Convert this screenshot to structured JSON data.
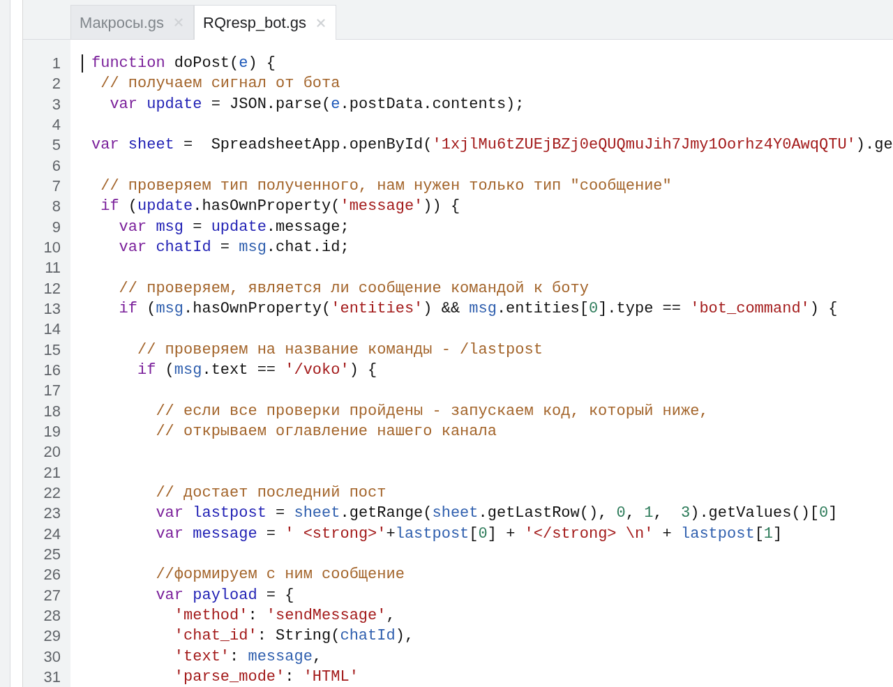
{
  "tabs": [
    {
      "label": "Макросы.gs",
      "selected": false
    },
    {
      "label": "RQresp_bot.gs",
      "selected": true
    }
  ],
  "lines": [
    {
      "number": "1",
      "tokens": [
        {
          "kind": "keyword",
          "text": "function"
        },
        {
          "kind": "plain",
          "text": " doPost("
        },
        {
          "kind": "param",
          "text": "e"
        },
        {
          "kind": "plain",
          "text": ") {"
        }
      ]
    },
    {
      "number": "2",
      "tokens": [
        {
          "kind": "comment",
          "text": " // получаем сигнал от бота"
        }
      ]
    },
    {
      "number": "3",
      "tokens": [
        {
          "kind": "keyword",
          "text": "  var "
        },
        {
          "kind": "def",
          "text": "update"
        },
        {
          "kind": "plain",
          "text": " = JSON.parse("
        },
        {
          "kind": "param",
          "text": "e"
        },
        {
          "kind": "plain",
          "text": ".postData.contents);"
        }
      ]
    },
    {
      "number": "4"
    },
    {
      "number": "5",
      "tokens": [
        {
          "kind": "keyword",
          "text": "var "
        },
        {
          "kind": "def",
          "text": "sheet"
        },
        {
          "kind": "plain",
          "text": " =  SpreadsheetApp.openById("
        },
        {
          "kind": "string",
          "text": "'1xjlMu6tZUEjBZj0eQUQmuJih7Jmy1Oorhz4Y0AwqQTU'"
        },
        {
          "kind": "plain",
          "text": ").ge"
        }
      ]
    },
    {
      "number": "6"
    },
    {
      "number": "7",
      "tokens": [
        {
          "kind": "comment",
          "text": " // проверяем тип полученного, нам нужен только тип \"сообщение\""
        }
      ]
    },
    {
      "number": "8",
      "tokens": [
        {
          "kind": "keyword",
          "text": " if"
        },
        {
          "kind": "plain",
          "text": " ("
        },
        {
          "kind": "def",
          "text": "update"
        },
        {
          "kind": "plain",
          "text": ".hasOwnProperty("
        },
        {
          "kind": "string",
          "text": "'message'"
        },
        {
          "kind": "plain",
          "text": ")) {"
        }
      ]
    },
    {
      "number": "9",
      "tokens": [
        {
          "kind": "keyword",
          "text": "   var "
        },
        {
          "kind": "def",
          "text": "msg"
        },
        {
          "kind": "plain",
          "text": " = "
        },
        {
          "kind": "def",
          "text": "update"
        },
        {
          "kind": "plain",
          "text": ".message;"
        }
      ]
    },
    {
      "number": "10",
      "tokens": [
        {
          "kind": "keyword",
          "text": "   var "
        },
        {
          "kind": "def",
          "text": "chatId"
        },
        {
          "kind": "plain",
          "text": " = "
        },
        {
          "kind": "variable",
          "text": "msg"
        },
        {
          "kind": "plain",
          "text": ".chat.id;"
        }
      ]
    },
    {
      "number": "11"
    },
    {
      "number": "12",
      "tokens": [
        {
          "kind": "comment",
          "text": "   // проверяем, является ли сообщение командой к боту"
        }
      ]
    },
    {
      "number": "13",
      "tokens": [
        {
          "kind": "keyword",
          "text": "   if"
        },
        {
          "kind": "plain",
          "text": " ("
        },
        {
          "kind": "variable",
          "text": "msg"
        },
        {
          "kind": "plain",
          "text": ".hasOwnProperty("
        },
        {
          "kind": "string",
          "text": "'entities'"
        },
        {
          "kind": "plain",
          "text": ") && "
        },
        {
          "kind": "variable",
          "text": "msg"
        },
        {
          "kind": "plain",
          "text": ".entities["
        },
        {
          "kind": "number",
          "text": "0"
        },
        {
          "kind": "plain",
          "text": "].type == "
        },
        {
          "kind": "string",
          "text": "'bot_command'"
        },
        {
          "kind": "plain",
          "text": ") {"
        }
      ]
    },
    {
      "number": "14"
    },
    {
      "number": "15",
      "tokens": [
        {
          "kind": "comment",
          "text": "     // проверяем на название команды - /lastpost"
        }
      ]
    },
    {
      "number": "16",
      "tokens": [
        {
          "kind": "keyword",
          "text": "     if"
        },
        {
          "kind": "plain",
          "text": " ("
        },
        {
          "kind": "variable",
          "text": "msg"
        },
        {
          "kind": "plain",
          "text": ".text == "
        },
        {
          "kind": "string",
          "text": "'/voko'"
        },
        {
          "kind": "plain",
          "text": ") {"
        }
      ]
    },
    {
      "number": "17"
    },
    {
      "number": "18",
      "tokens": [
        {
          "kind": "comment",
          "text": "       // если все проверки пройдены - запускаем код, который ниже,"
        }
      ]
    },
    {
      "number": "19",
      "tokens": [
        {
          "kind": "comment",
          "text": "       // открываем оглавление нашего канала"
        }
      ]
    },
    {
      "number": "20"
    },
    {
      "number": "21"
    },
    {
      "number": "22",
      "tokens": [
        {
          "kind": "comment",
          "text": "       // достает последний пост"
        }
      ]
    },
    {
      "number": "23",
      "tokens": [
        {
          "kind": "keyword",
          "text": "       var "
        },
        {
          "kind": "def",
          "text": "lastpost"
        },
        {
          "kind": "plain",
          "text": " = "
        },
        {
          "kind": "variable",
          "text": "sheet"
        },
        {
          "kind": "plain",
          "text": ".getRange("
        },
        {
          "kind": "variable",
          "text": "sheet"
        },
        {
          "kind": "plain",
          "text": ".getLastRow(), "
        },
        {
          "kind": "number",
          "text": "0"
        },
        {
          "kind": "plain",
          "text": ", "
        },
        {
          "kind": "number",
          "text": "1"
        },
        {
          "kind": "plain",
          "text": ",  "
        },
        {
          "kind": "number",
          "text": "3"
        },
        {
          "kind": "plain",
          "text": ").getValues()["
        },
        {
          "kind": "number",
          "text": "0"
        },
        {
          "kind": "plain",
          "text": "]"
        }
      ]
    },
    {
      "number": "24",
      "tokens": [
        {
          "kind": "keyword",
          "text": "       var "
        },
        {
          "kind": "def",
          "text": "message"
        },
        {
          "kind": "plain",
          "text": " = "
        },
        {
          "kind": "string",
          "text": "' <strong>'"
        },
        {
          "kind": "plain",
          "text": "+"
        },
        {
          "kind": "variable",
          "text": "lastpost"
        },
        {
          "kind": "plain",
          "text": "["
        },
        {
          "kind": "number",
          "text": "0"
        },
        {
          "kind": "plain",
          "text": "] + "
        },
        {
          "kind": "string",
          "text": "'</strong> \\n'"
        },
        {
          "kind": "plain",
          "text": " + "
        },
        {
          "kind": "variable",
          "text": "lastpost"
        },
        {
          "kind": "plain",
          "text": "["
        },
        {
          "kind": "number",
          "text": "1"
        },
        {
          "kind": "plain",
          "text": "]"
        }
      ]
    },
    {
      "number": "25"
    },
    {
      "number": "26",
      "tokens": [
        {
          "kind": "comment",
          "text": "       //формируем с ним сообщение"
        }
      ]
    },
    {
      "number": "27",
      "tokens": [
        {
          "kind": "keyword",
          "text": "       var "
        },
        {
          "kind": "def",
          "text": "payload"
        },
        {
          "kind": "plain",
          "text": " = {"
        }
      ]
    },
    {
      "number": "28",
      "tokens": [
        {
          "kind": "string",
          "text": "         'method'"
        },
        {
          "kind": "plain",
          "text": ": "
        },
        {
          "kind": "string",
          "text": "'sendMessage'"
        },
        {
          "kind": "plain",
          "text": ","
        }
      ]
    },
    {
      "number": "29",
      "tokens": [
        {
          "kind": "string",
          "text": "         'chat_id'"
        },
        {
          "kind": "plain",
          "text": ": String("
        },
        {
          "kind": "variable",
          "text": "chatId"
        },
        {
          "kind": "plain",
          "text": "),"
        }
      ]
    },
    {
      "number": "30",
      "tokens": [
        {
          "kind": "string",
          "text": "         'text'"
        },
        {
          "kind": "plain",
          "text": ": "
        },
        {
          "kind": "variable",
          "text": "message"
        },
        {
          "kind": "plain",
          "text": ","
        }
      ]
    },
    {
      "number": "31",
      "tokens": [
        {
          "kind": "string",
          "text": "         'parse_mode'"
        },
        {
          "kind": "plain",
          "text": ": "
        },
        {
          "kind": "string",
          "text": "'HTML'"
        }
      ]
    }
  ]
}
